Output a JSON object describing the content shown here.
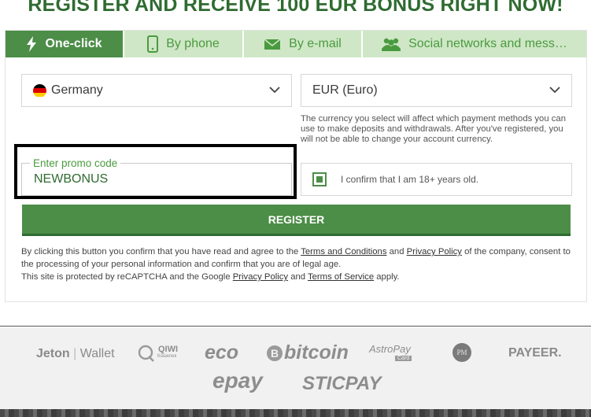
{
  "headline": "REGISTER AND RECEIVE 100 EUR BONUS RIGHT NOW!",
  "tabs": [
    {
      "label": "One-click",
      "icon": "lightning-icon",
      "active": true
    },
    {
      "label": "By phone",
      "icon": "phone-icon",
      "active": false
    },
    {
      "label": "By e-mail",
      "icon": "envelope-icon",
      "active": false
    },
    {
      "label": "Social networks and mess…",
      "icon": "users-icon",
      "active": false
    }
  ],
  "country": {
    "value": "Germany",
    "icon": "germany-flag-icon"
  },
  "currency": {
    "value": "EUR (Euro)"
  },
  "currency_note": "The currency you select will affect which payment methods you can use to make deposits and withdrawals. After you've registered, you will not be able to change your account currency.",
  "promo": {
    "label": "Enter promo code",
    "value": "NEWBONUS"
  },
  "age_confirm": {
    "label": "I confirm that I am 18+ years old.",
    "checked": true
  },
  "register_label": "REGISTER",
  "legal": {
    "p1_before": "By clicking this button you confirm that you have read and agree to the ",
    "terms_link": "Terms and Conditions",
    "and1": " and ",
    "privacy_link": "Privacy Policy",
    "p1_after": " of the company, consent to the processing of your personal information and confirm that you are of legal age.",
    "p2_before": "This site is protected by reCAPTCHA and the Google ",
    "google_privacy_link": "Privacy Policy",
    "and2": " and ",
    "tos_link": "Terms of Service",
    "p2_after": " apply."
  },
  "payment_methods": [
    {
      "name": "Jeton Wallet",
      "part1": "Jeton",
      "part2": "Wallet"
    },
    {
      "name": "QIWI",
      "label": "QIWI",
      "sub": "Кошелек"
    },
    {
      "name": "eco",
      "label": "eco"
    },
    {
      "name": "bitcoin",
      "label": "bitcoin"
    },
    {
      "name": "AstroPay",
      "label": "AstroPay",
      "sub": "Card"
    },
    {
      "name": "PM",
      "label": "PM"
    },
    {
      "name": "PAYEER",
      "label": "PAYEER."
    },
    {
      "name": "epay",
      "label": "epay"
    },
    {
      "name": "STICPAY",
      "label": "STICPAY"
    }
  ],
  "colors": {
    "brand_green": "#4c8d47",
    "dark_green": "#2f6b31",
    "tab_light": "#cfe7c6",
    "tab_text": "#4a9a3f"
  }
}
